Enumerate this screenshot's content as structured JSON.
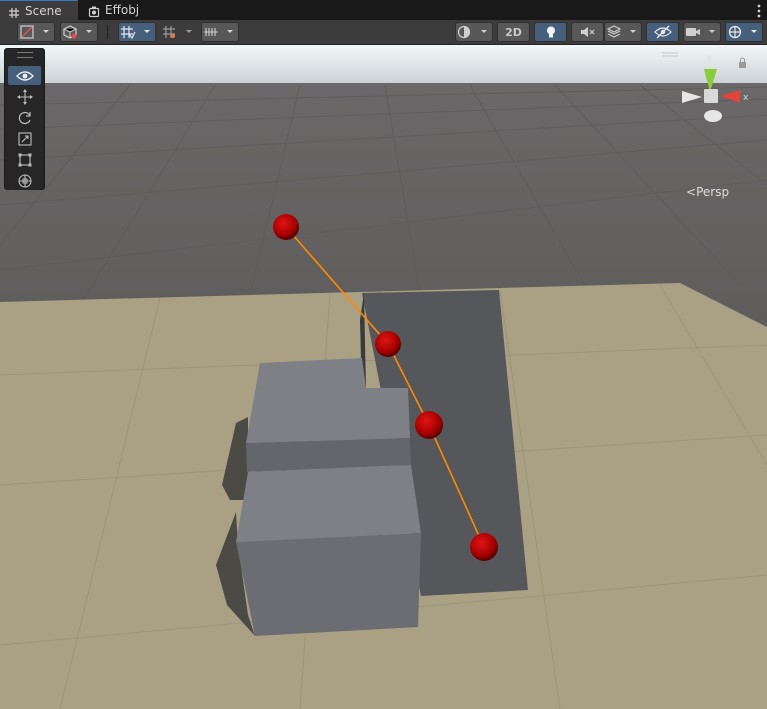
{
  "tabs": [
    {
      "label": "Scene",
      "icon": "grid-hash-icon",
      "active": true
    },
    {
      "label": "Effobj",
      "icon": "gameobject-icon",
      "active": false
    }
  ],
  "toolbar": {
    "mode_2d_label": "2D",
    "accent": "#46607c"
  },
  "gizmo": {
    "axis_x_label": "x",
    "axis_y_label": "y",
    "projection_label": "Persp"
  },
  "scene": {
    "sky_color": "#dfe8ee",
    "ground_color": "#52504e",
    "plane_color": "#a89f83",
    "path_color": "#ff8800",
    "sphere_color": "#b00000",
    "path_points": 4
  },
  "tools": [
    {
      "name": "view-tool",
      "icon": "eye-icon",
      "active": true
    },
    {
      "name": "move-tool",
      "icon": "move-arrows-icon",
      "active": false
    },
    {
      "name": "rotate-tool",
      "icon": "rotate-icon",
      "active": false
    },
    {
      "name": "scale-tool",
      "icon": "scale-icon",
      "active": false
    },
    {
      "name": "rect-tool",
      "icon": "rect-icon",
      "active": false
    },
    {
      "name": "transform-tool",
      "icon": "transform-icon",
      "active": false
    }
  ]
}
